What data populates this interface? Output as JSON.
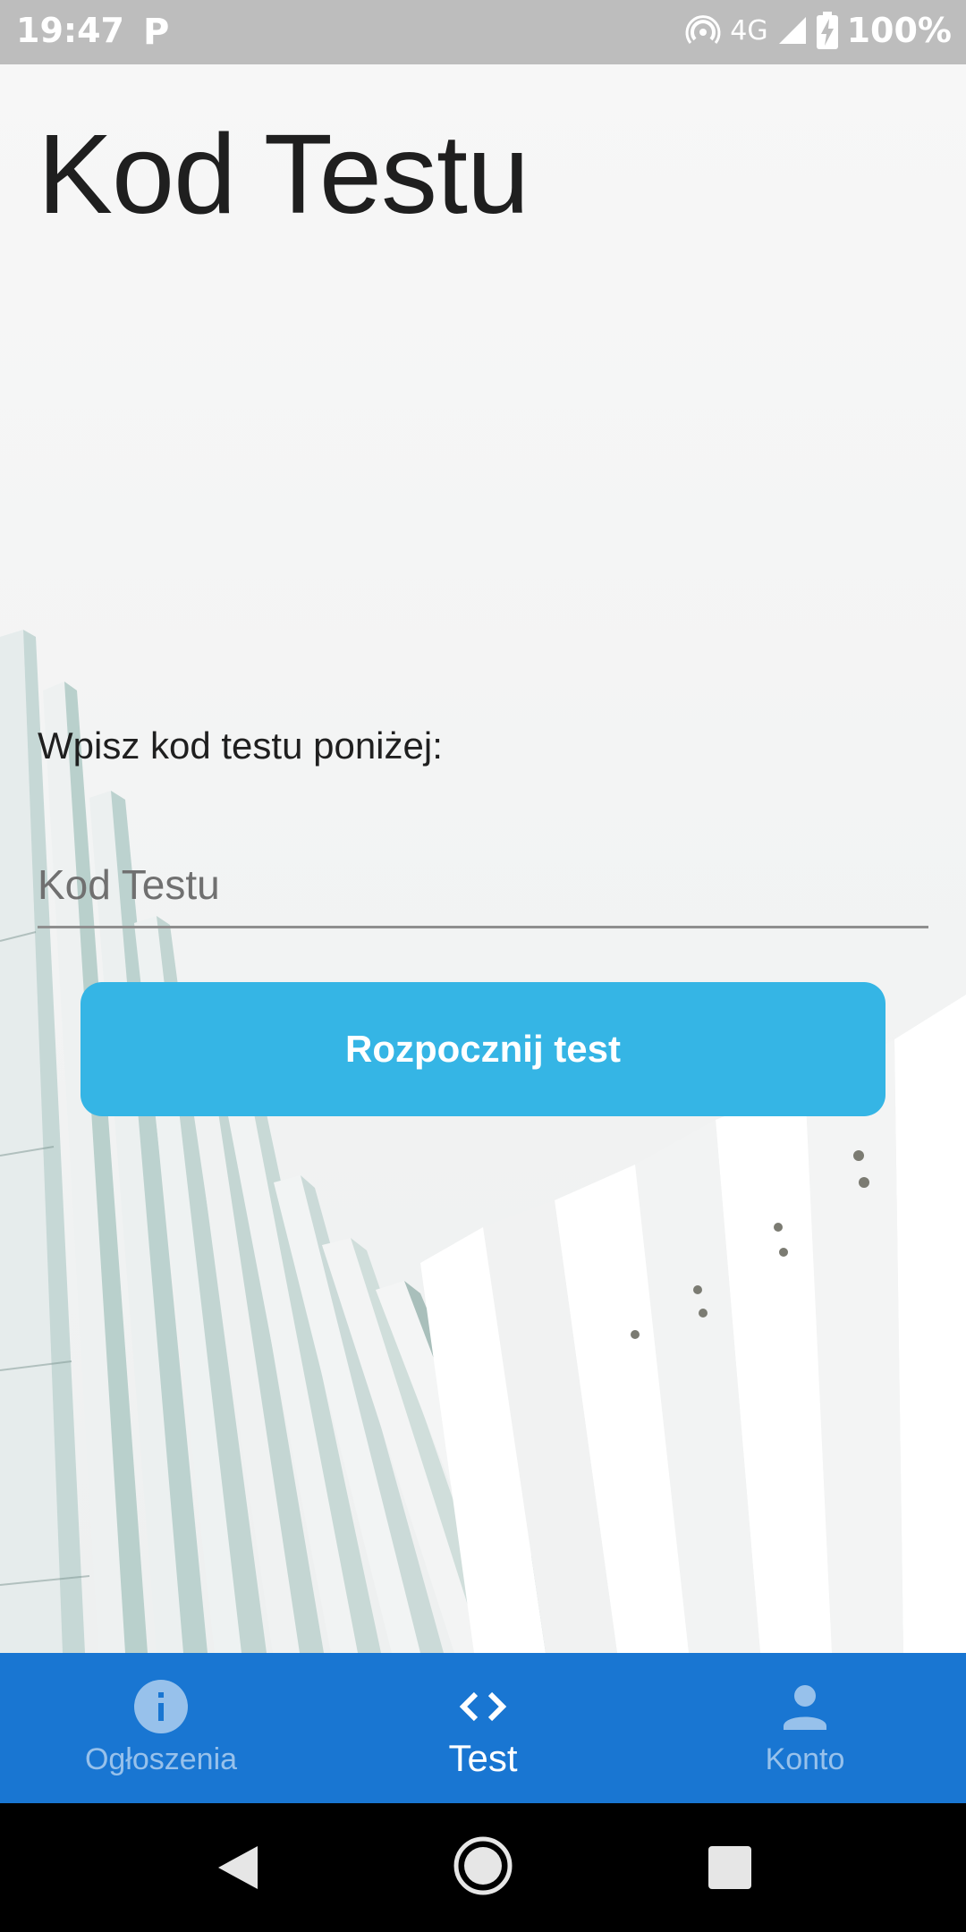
{
  "status_bar": {
    "time": "19:47",
    "notification": "P",
    "network": "4G",
    "battery": "100%"
  },
  "page": {
    "title": "Kod Testu",
    "instruction": "Wpisz kod testu poniżej:",
    "code_input": {
      "value": "",
      "placeholder": "Kod Testu"
    },
    "start_button": "Rozpocznij test"
  },
  "bottom_nav": {
    "items": [
      {
        "label": "Ogłoszenia",
        "icon": "info-icon",
        "active": false
      },
      {
        "label": "Test",
        "icon": "code-icon",
        "active": true
      },
      {
        "label": "Konto",
        "icon": "person-icon",
        "active": false
      }
    ]
  },
  "system_nav": {
    "icons": [
      "back-icon",
      "home-icon",
      "recents-icon"
    ]
  },
  "colors": {
    "status_bar": "#bdbdbd",
    "accent_button": "#35b5e5",
    "bottom_nav": "#1976d2",
    "text": "#1f1f1f"
  }
}
